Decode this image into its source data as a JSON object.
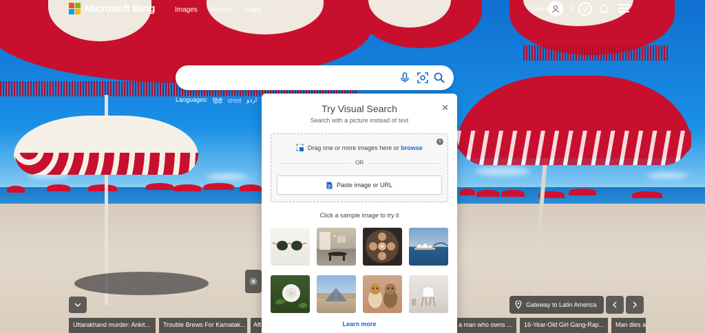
{
  "header": {
    "brand": "Microsoft Bing",
    "nav": [
      "Images",
      "Videos",
      "Maps"
    ],
    "more": "···",
    "user_name": "Selva",
    "points": "6"
  },
  "search": {
    "value": "",
    "placeholder": ""
  },
  "languages": {
    "label": "Languages:",
    "items": [
      "हिंदी",
      "বাংলা",
      "اردو"
    ]
  },
  "visual_search": {
    "title": "Try Visual Search",
    "subtitle": "Search with a picture instead of text",
    "drag_text": "Drag one or more images here or",
    "browse_link": "browse",
    "or": "OR",
    "paste_button": "Paste image or URL",
    "sample_label": "Click a sample image to try it",
    "learn_more": "Learn more",
    "samples": [
      "sunglasses",
      "dining-room",
      "latte-art",
      "sydney-opera-house",
      "white-rose",
      "louvre-pyramid",
      "dogs",
      "white-chair"
    ]
  },
  "bottom": {
    "gateway": "Gateway to Latin America",
    "news": [
      "Uttarakhand murder: Ankit...",
      "Trouble Brews For Karnatak...",
      "Aft",
      "a man who owns ...",
      "16-Year-Old Girl Gang-Rap...",
      "Man dies a"
    ]
  },
  "colors": {
    "accent": "#1a66c9",
    "umbrella_red": "#c8102e"
  }
}
